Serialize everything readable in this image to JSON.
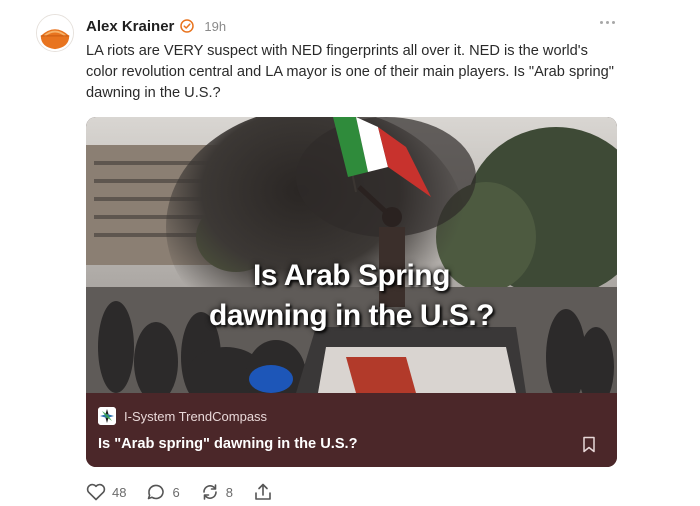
{
  "post": {
    "author": "Alex Krainer",
    "timestamp": "19h",
    "body": "LA riots are VERY suspect with NED fingerprints all over it. NED is the world's color revolution central and LA mayor is one of their main players. Is \"Arab spring\" dawning in the U.S.?",
    "icons": {
      "verified": "verified-badge-icon",
      "more": "more-options-icon"
    }
  },
  "card": {
    "image_caption_line1": "Is Arab Spring",
    "image_caption_line2": "dawning in the U.S.?",
    "source_name": "I-System TrendCompass",
    "title": "Is \"Arab spring\" dawning in the U.S.?",
    "footer_color": "#4b2729",
    "icons": {
      "bookmark": "bookmark-icon"
    }
  },
  "actions": {
    "likes": "48",
    "comments": "6",
    "restacks": "8",
    "icons": {
      "like": "heart-icon",
      "comment": "comment-icon",
      "restack": "restack-icon",
      "share": "share-icon"
    }
  },
  "colors": {
    "accent": "#e8741f",
    "muted": "#8a8a8a"
  }
}
